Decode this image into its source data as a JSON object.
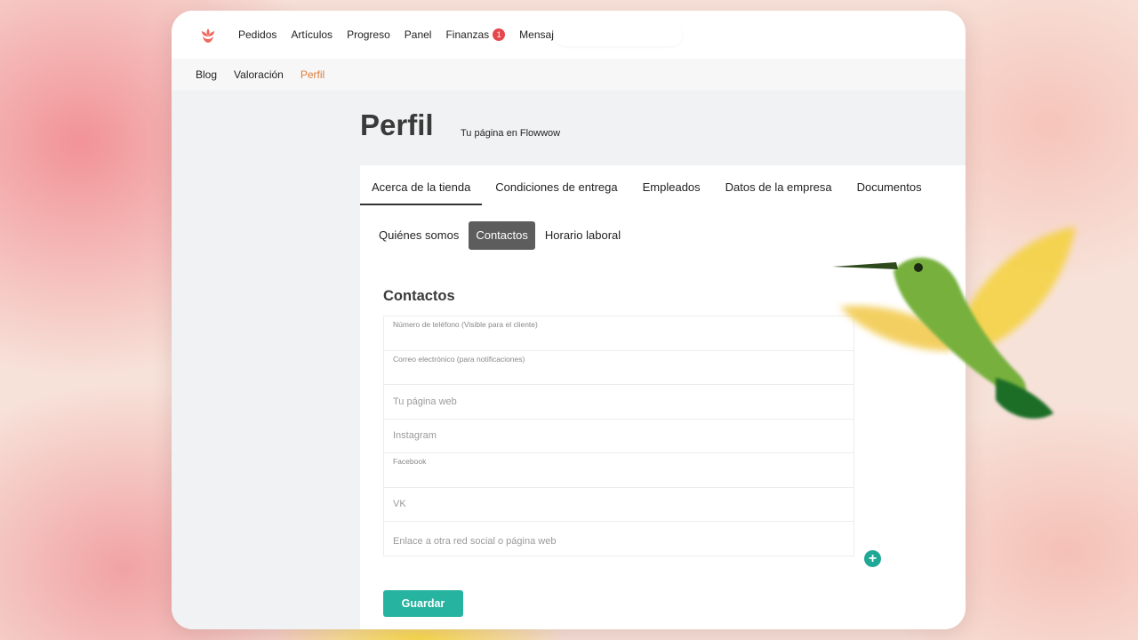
{
  "topnav": {
    "items": [
      "Pedidos",
      "Artículos",
      "Progreso",
      "Panel",
      "Finanzas",
      "Mensajes"
    ],
    "finanzas_badge": "1"
  },
  "subnav": {
    "items": [
      "Blog",
      "Valoración",
      "Perfil"
    ],
    "active": "Perfil"
  },
  "page": {
    "title": "Perfil",
    "subtitle": "Tu página en Flowwow"
  },
  "tabs": [
    "Acerca de la tienda",
    "Condiciones de entrega",
    "Empleados",
    "Datos de la empresa",
    "Documentos"
  ],
  "active_tab": "Acerca de la tienda",
  "subtabs": [
    "Quiénes somos",
    "Contactos",
    "Horario laboral"
  ],
  "active_subtab": "Contactos",
  "contacts": {
    "title": "Contactos",
    "fields": [
      {
        "label": "Número de teléfono (Visible para el cliente)"
      },
      {
        "label": "Correo electrónico (para notificaciones)"
      },
      {
        "placeholder": "Tu página web"
      },
      {
        "placeholder": "Instagram"
      },
      {
        "label": "Facebook"
      },
      {
        "placeholder": "VK"
      },
      {
        "placeholder": "Enlace a otra red social o página web"
      }
    ],
    "save_label": "Guardar"
  },
  "colors": {
    "accent_teal": "#26b3a0",
    "active_orange": "#e07b39",
    "badge_red": "#e5484d",
    "logo_coral": "#ee6a5f"
  }
}
